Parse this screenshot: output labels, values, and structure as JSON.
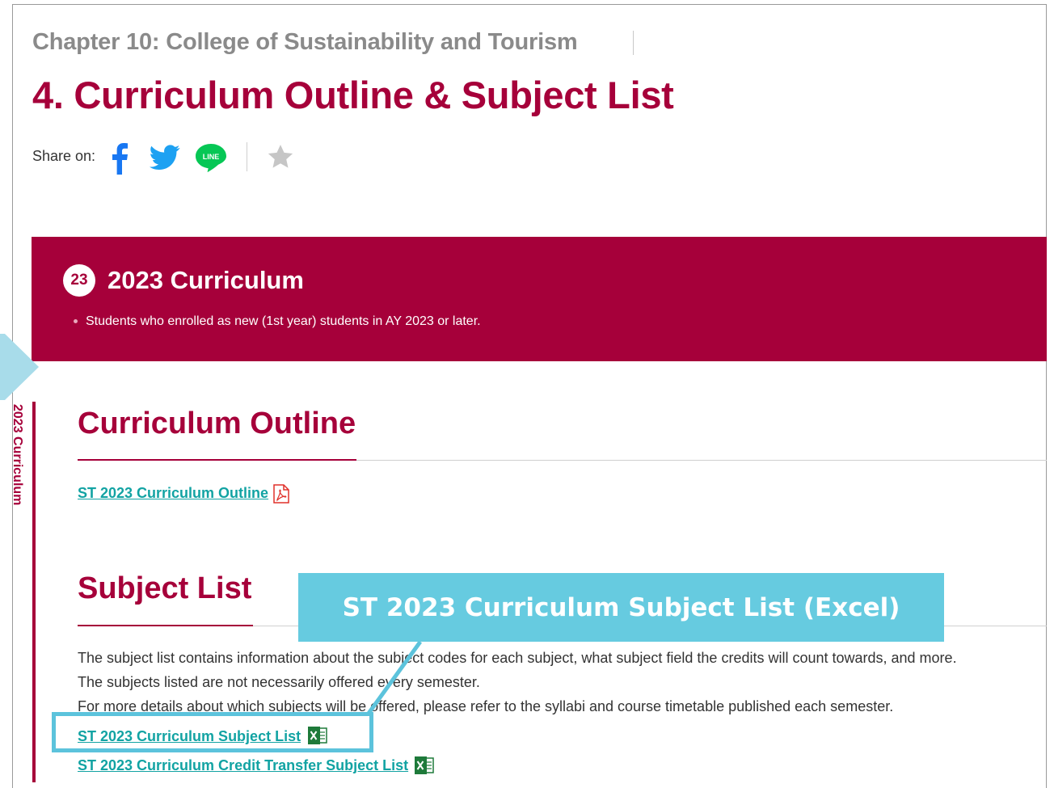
{
  "header": {
    "chapter": "Chapter 10: College of Sustainability and Tourism",
    "title": "4. Curriculum Outline & Subject List"
  },
  "share": {
    "label": "Share on:",
    "icons": [
      "facebook-icon",
      "twitter-icon",
      "line-icon",
      "star-icon"
    ],
    "line_text": "LINE"
  },
  "banner": {
    "badge": "23",
    "title": "2023 Curriculum",
    "note": "Students who enrolled as new (1st year) students in AY 2023 or later."
  },
  "side_label": "2023 Curriculum",
  "outline": {
    "heading": "Curriculum Outline",
    "link": "ST 2023 Curriculum Outline",
    "file_icon": "pdf-icon"
  },
  "subject_list": {
    "heading": "Subject List",
    "paragraphs": [
      "The subject list contains information about the subject codes for each subject, what subject field the credits will count towards, and more.",
      "The subjects listed are not necessarily offered every semester.",
      "For more details about which subjects will be offered, please refer to the syllabi and course timetable published each semester."
    ],
    "links": [
      {
        "label": "ST 2023 Curriculum Subject List",
        "file_icon": "excel-icon"
      },
      {
        "label": "ST 2023 Curriculum Credit Transfer Subject List",
        "file_icon": "excel-icon"
      }
    ]
  },
  "callout": {
    "text": "ST 2023 Curriculum Subject List (Excel)"
  },
  "colors": {
    "brand": "#a6003a",
    "link": "#12a3a3",
    "callout": "#66cbe0",
    "facebook": "#1877f2",
    "twitter": "#1da1f2",
    "line": "#06c755",
    "excel": "#1e7a3a",
    "pdf": "#e0302a"
  }
}
